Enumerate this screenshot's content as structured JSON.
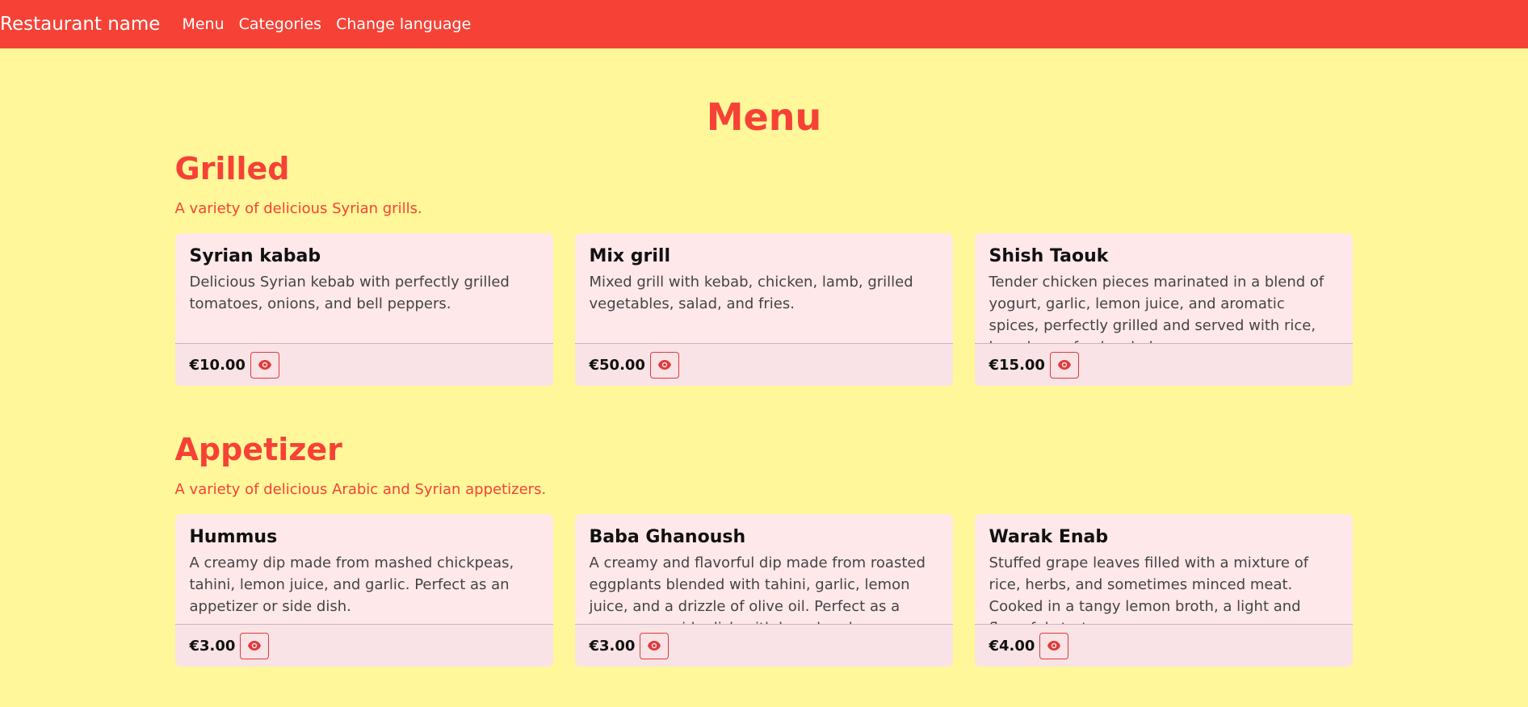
{
  "nav": {
    "brand": "Restaurant name",
    "links": [
      "Menu",
      "Categories",
      "Change language"
    ]
  },
  "page": {
    "title": "Menu"
  },
  "sections": [
    {
      "title": "Grilled",
      "description": "A variety of delicious Syrian grills.",
      "items": [
        {
          "name": "Syrian kabab",
          "description": "Delicious Syrian kebab with perfectly grilled tomatoes, onions, and bell peppers.",
          "price": "€10.00"
        },
        {
          "name": "Mix grill",
          "description": "Mixed grill with kebab, chicken, lamb, grilled vegetables, salad, and fries.",
          "price": "€50.00"
        },
        {
          "name": "Shish Taouk",
          "description": "Tender chicken pieces marinated in a blend of yogurt, garlic, lemon juice, and aromatic spices, perfectly grilled and served with rice, bread, or a fresh salad.",
          "price": "€15.00"
        }
      ]
    },
    {
      "title": "Appetizer",
      "description": "A variety of delicious Arabic and Syrian appetizers.",
      "items": [
        {
          "name": "Hummus",
          "description": "A creamy dip made from mashed chickpeas, tahini, lemon juice, and garlic. Perfect as an appetizer or side dish.",
          "price": "€3.00"
        },
        {
          "name": "Baba Ghanoush",
          "description": "A creamy and flavorful dip made from roasted eggplants blended with tahini, garlic, lemon juice, and a drizzle of olive oil. Perfect as a mezze or a side dish with bread and vegetables.",
          "price": "€3.00"
        },
        {
          "name": "Warak Enab",
          "description": "Stuffed grape leaves filled with a mixture of rice, herbs, and sometimes minced meat. Cooked in a tangy lemon broth, a light and flavorful starter.",
          "price": "€4.00"
        }
      ]
    }
  ],
  "colors": {
    "accent": "#f64236",
    "background": "#fff799",
    "card": "#ffe8ea"
  }
}
